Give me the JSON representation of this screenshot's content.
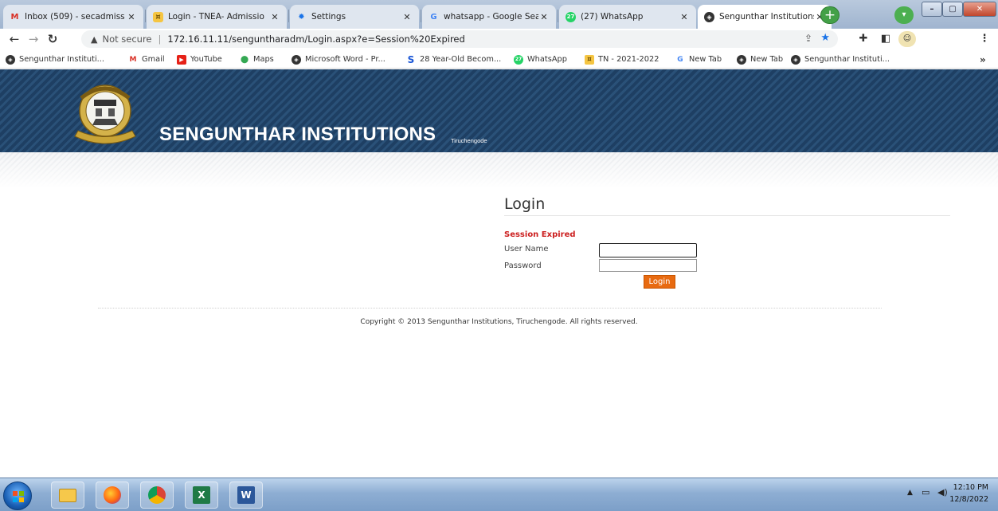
{
  "browser": {
    "tabs": [
      {
        "title": "Inbox (509) - secadmiss",
        "favicon": "gmail-icon"
      },
      {
        "title": "Login - TNEA- Admissio",
        "favicon": "tnea-icon"
      },
      {
        "title": "Settings",
        "favicon": "settings-gear-icon"
      },
      {
        "title": "whatsapp - Google Sea",
        "favicon": "google-icon"
      },
      {
        "title": "(27) WhatsApp",
        "favicon": "whatsapp-icon"
      },
      {
        "title": "Sengunthar Institutions",
        "favicon": "globe-icon",
        "active": true
      }
    ],
    "omnibox": {
      "security": "Not secure",
      "url": "172.16.11.11/senguntharаdm/Login.aspx?e=Session%20Expired"
    },
    "bookmarks": [
      {
        "label": "Sengunthar Instituti...",
        "icon": "globe-icon"
      },
      {
        "label": "Gmail",
        "icon": "gmail-icon"
      },
      {
        "label": "YouTube",
        "icon": "youtube-icon"
      },
      {
        "label": "Maps",
        "icon": "maps-icon"
      },
      {
        "label": "Microsoft Word - Pr...",
        "icon": "globe-icon"
      },
      {
        "label": "28 Year-Old Becom...",
        "icon": "s-logo-icon"
      },
      {
        "label": "WhatsApp",
        "icon": "whatsapp-icon"
      },
      {
        "label": "TN - 2021-2022",
        "icon": "tnea-icon"
      },
      {
        "label": "New Tab",
        "icon": "google-icon"
      },
      {
        "label": "New Tab",
        "icon": "globe-icon"
      },
      {
        "label": "Sengunthar Instituti...",
        "icon": "globe-icon"
      }
    ],
    "bookmarks_more": "»"
  },
  "site": {
    "title": "SENGUNTHAR INSTITUTIONS",
    "subtitle": "Tiruchengode"
  },
  "login": {
    "heading": "Login",
    "message": "Session Expired",
    "username_label": "User Name",
    "password_label": "Password",
    "username_value": "",
    "password_value": "",
    "button": "Login"
  },
  "footer": {
    "copyright": "Copyright © 2013 Sengunthar Institutions, Tiruchengode. All rights reserved."
  },
  "taskbar": {
    "apps": [
      "explorer-icon",
      "firefox-icon",
      "chrome-icon",
      "excel-icon",
      "word-icon"
    ],
    "time": "12:10 PM",
    "date": "12/8/2022"
  },
  "colors": {
    "banner": "#1e3f63",
    "accent": "#e86a10",
    "error": "#cc1f1f"
  }
}
